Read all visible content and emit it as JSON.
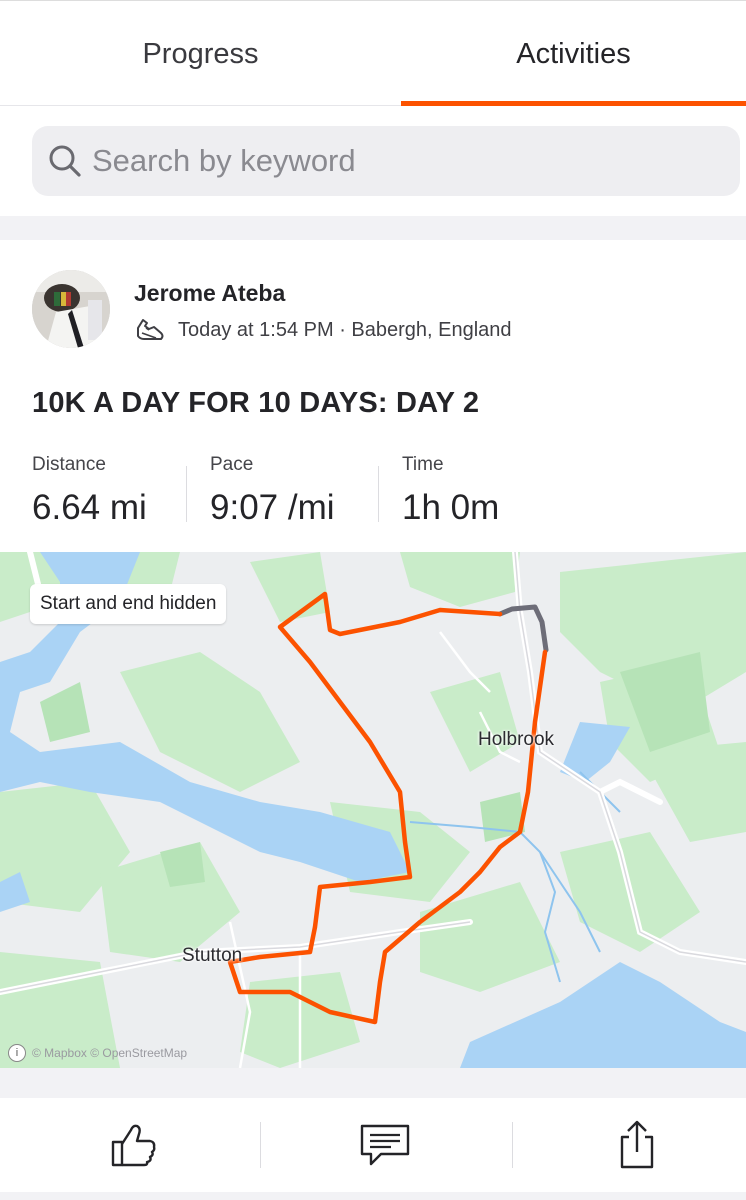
{
  "tabs": [
    {
      "label": "Progress",
      "active": false
    },
    {
      "label": "Activities",
      "active": true
    }
  ],
  "search": {
    "placeholder": "Search by keyword",
    "value": "",
    "icon": "search-icon"
  },
  "activity": {
    "athlete_name": "Jerome Ateba",
    "sport_icon": "running-shoe-icon",
    "meta": "Today at 1:54 PM · Babergh, England",
    "title": "10K A DAY FOR 10 DAYS: DAY 2",
    "stats": [
      {
        "label": "Distance",
        "value": "6.64 mi"
      },
      {
        "label": "Pace",
        "value": "9:07 /mi"
      },
      {
        "label": "Time",
        "value": "1h 0m"
      }
    ],
    "map": {
      "privacy_label": "Start and end hidden",
      "places": [
        "Holbrook",
        "Stutton"
      ],
      "attribution": "© Mapbox © OpenStreetMap",
      "route_color": "#fc5200",
      "hidden_segment_color": "#6d6d78"
    }
  },
  "actions": [
    {
      "name": "kudos",
      "icon": "thumbs-up-icon"
    },
    {
      "name": "comment",
      "icon": "comment-icon"
    },
    {
      "name": "share",
      "icon": "share-icon"
    }
  ],
  "colors": {
    "accent": "#fc5200",
    "water": "#aad3f5",
    "park": "#c8edc9"
  }
}
